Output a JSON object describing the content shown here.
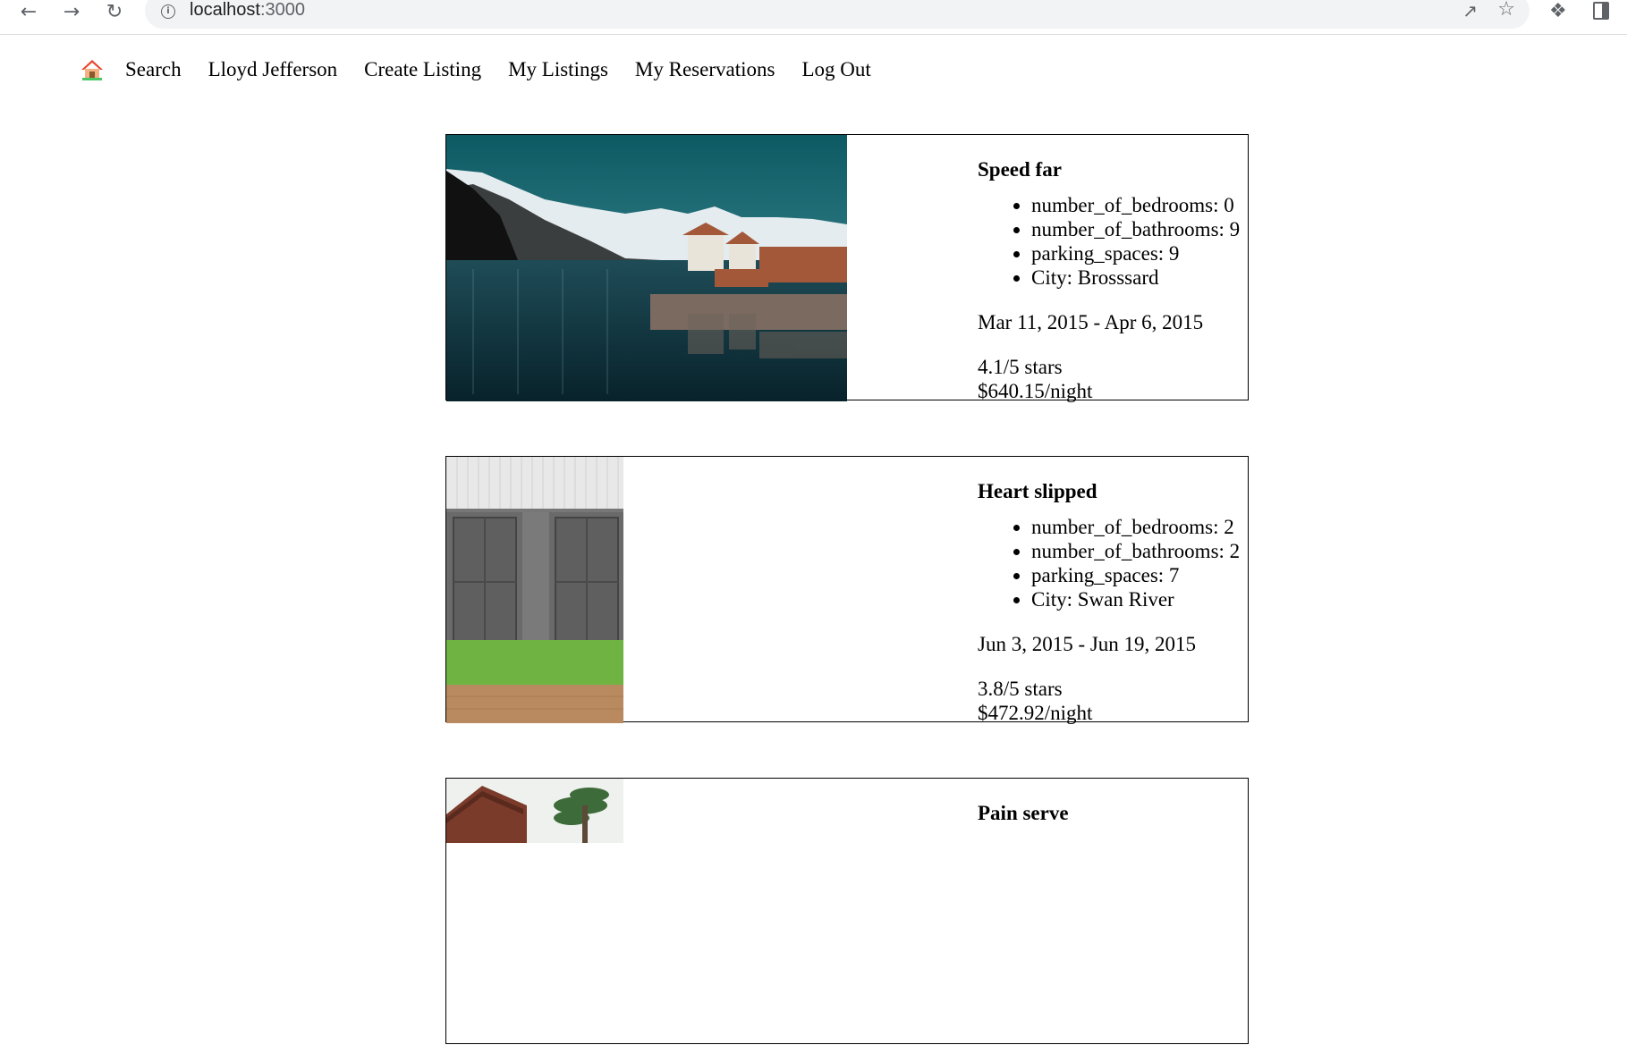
{
  "browser": {
    "url_host": "localhost",
    "url_port": ":3000"
  },
  "nav": {
    "home_icon": "house-icon",
    "links": [
      "Search",
      "Lloyd Jefferson",
      "Create Listing",
      "My Listings",
      "My Reservations",
      "Log Out"
    ]
  },
  "listings": [
    {
      "title": "Speed far",
      "details": [
        "number_of_bedrooms: 0",
        "number_of_bathrooms: 9",
        "parking_spaces: 9",
        "City: Brosssard"
      ],
      "dates": "Mar 11, 2015 - Apr 6, 2015",
      "rating": "4.1/5 stars",
      "price": "$640.15/night",
      "image": "lake-mountain-village-photo"
    },
    {
      "title": "Heart slipped",
      "details": [
        "number_of_bedrooms: 2",
        "number_of_bathrooms: 2",
        "parking_spaces: 7",
        "City: Swan River"
      ],
      "dates": "Jun 3, 2015 - Jun 19, 2015",
      "rating": "3.8/5 stars",
      "price": "$472.92/night",
      "image": "garage-doors-lawn-photo"
    },
    {
      "title": "Pain serve",
      "image": "roof-palm-tree-photo"
    }
  ]
}
